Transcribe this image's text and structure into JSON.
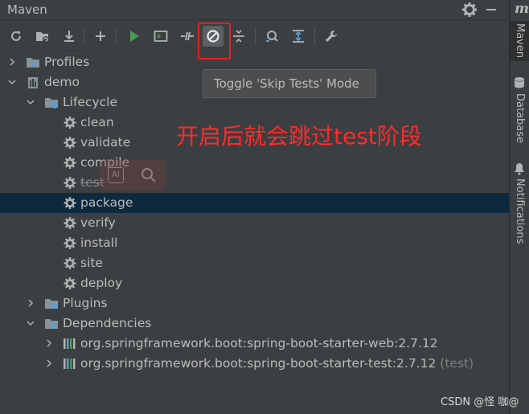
{
  "panel": {
    "title": "Maven",
    "toolbar": {
      "buttons": [
        {
          "name": "reload-icon"
        },
        {
          "name": "generate-sources-icon"
        },
        {
          "name": "download-icon"
        },
        {
          "name": "add-icon"
        },
        {
          "name": "run-icon"
        },
        {
          "name": "execute-goal-icon"
        },
        {
          "name": "toggle-offline-icon"
        },
        {
          "name": "skip-tests-icon"
        },
        {
          "name": "collapse-icon"
        },
        {
          "name": "show-dependencies-icon"
        },
        {
          "name": "expand-icon"
        },
        {
          "name": "settings-wrench-icon"
        }
      ]
    },
    "tooltip": "Toggle 'Skip Tests' Mode",
    "annotation": "开启后就会跳过test阶段"
  },
  "tree": {
    "profiles": "Profiles",
    "project": "demo",
    "lifecycle": "Lifecycle",
    "goals": [
      "clean",
      "validate",
      "compile",
      "test",
      "package",
      "verify",
      "install",
      "site",
      "deploy"
    ],
    "plugins": "Plugins",
    "dependencies": "Dependencies",
    "deps": [
      {
        "label": "org.springframework.boot:spring-boot-starter-web:2.7.12",
        "suffix": ""
      },
      {
        "label": "org.springframework.boot:spring-boot-starter-test:2.7.12",
        "suffix": "(test)"
      }
    ]
  },
  "rightbar": {
    "logo": "m",
    "tabs": [
      "Maven",
      "Database",
      "Notifications"
    ]
  },
  "watermark": "CSDN @怪 咖@",
  "colors": {
    "background": "#3c3f41",
    "selection": "#0d293e",
    "annotation": "#ff2b2b",
    "text": "#bbbbbb",
    "run_green": "#499c54",
    "folder_blue": "#5e9ccc"
  }
}
